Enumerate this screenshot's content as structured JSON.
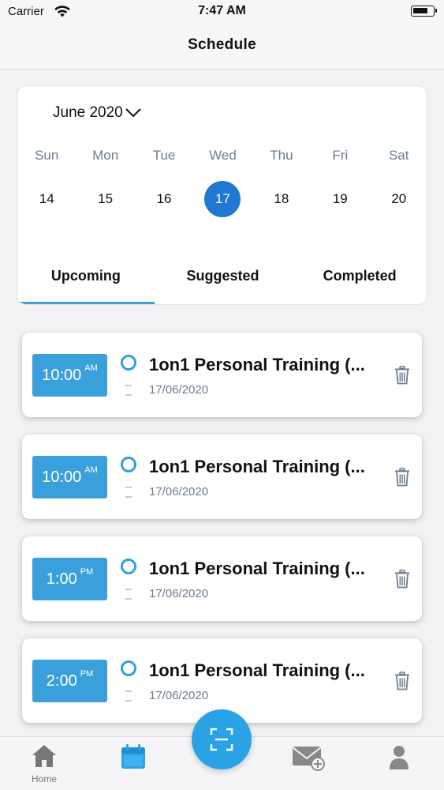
{
  "status_bar": {
    "carrier": "Carrier",
    "time": "7:47 AM"
  },
  "header": {
    "title": "Schedule"
  },
  "calendar": {
    "month": "June 2020",
    "weekdays": [
      "Sun",
      "Mon",
      "Tue",
      "Wed",
      "Thu",
      "Fri",
      "Sat"
    ],
    "days": [
      "14",
      "15",
      "16",
      "17",
      "18",
      "19",
      "20"
    ],
    "selected_day": "17",
    "selected_color": "#1f78d1"
  },
  "tabs": [
    {
      "label": "Upcoming",
      "active": true
    },
    {
      "label": "Suggested",
      "active": false
    },
    {
      "label": "Completed",
      "active": false
    }
  ],
  "accent_color": "#3aa0dc",
  "sessions": [
    {
      "time": "10:00",
      "ampm": "AM",
      "title": "1on1 Personal Training (...",
      "date": "17/06/2020"
    },
    {
      "time": "10:00",
      "ampm": "AM",
      "title": "1on1 Personal Training (...",
      "date": "17/06/2020"
    },
    {
      "time": "1:00",
      "ampm": "PM",
      "title": "1on1 Personal Training (...",
      "date": "17/06/2020"
    },
    {
      "time": "2:00",
      "ampm": "PM",
      "title": "1on1 Personal Training (...",
      "date": "17/06/2020"
    }
  ],
  "tabbar": {
    "items": [
      {
        "icon": "home-icon",
        "label": "Home"
      },
      {
        "icon": "calendar-icon",
        "label": ""
      },
      {
        "icon": "scan-icon",
        "label": ""
      },
      {
        "icon": "mail-add-icon",
        "label": ""
      },
      {
        "icon": "profile-icon",
        "label": ""
      }
    ]
  }
}
